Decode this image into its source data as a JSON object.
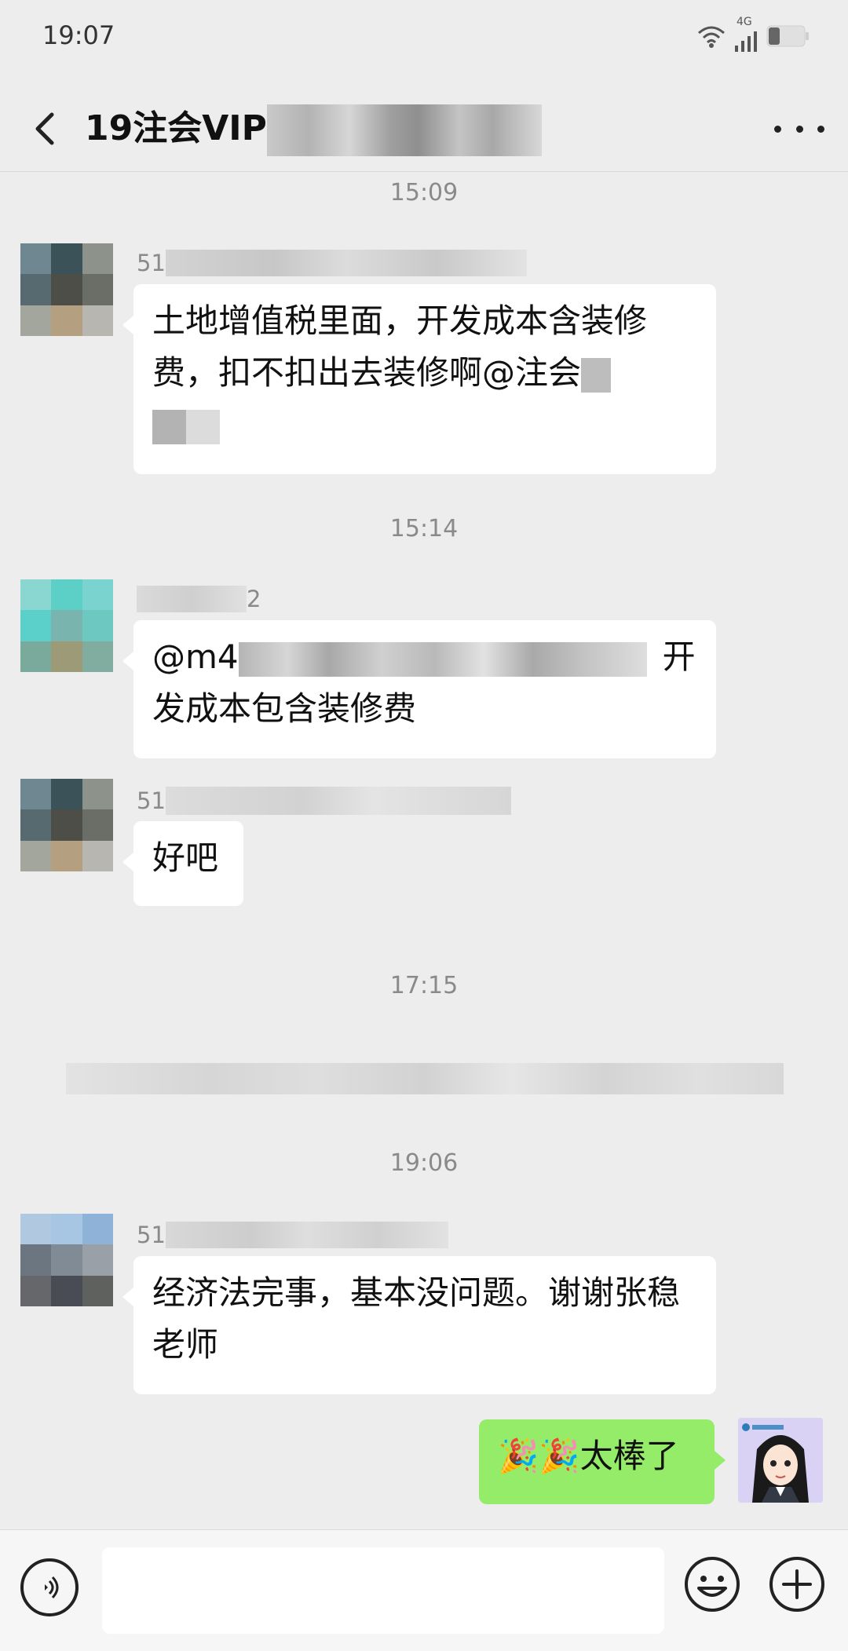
{
  "status_bar": {
    "time": "19:07",
    "network": "4G"
  },
  "nav": {
    "title_prefix": "19注会VIP"
  },
  "timestamps": [
    "15:09",
    "15:14",
    "17:15",
    "19:06"
  ],
  "messages": [
    {
      "sender_prefix": "51",
      "text_a": "土地增值税里面，开发成本含装修费，扣不扣出去装修啊@注会",
      "text_b": ""
    },
    {
      "sender_suffix": "2",
      "text_a": "@m4",
      "text_b": "开发成本包含装修费"
    },
    {
      "sender_prefix": "51",
      "text_a": "好吧"
    },
    {
      "sender_prefix": "51",
      "text_a": "经济法完事，基本没问题。谢谢张稳老师"
    },
    {
      "text_a": "🎉🎉太棒了"
    }
  ],
  "colors": {
    "background": "#ededed",
    "my_bubble": "#95ec69",
    "other_bubble": "#ffffff",
    "timestamp": "#8a8a8a"
  },
  "icons": [
    "back-icon",
    "more-icon",
    "wifi-icon",
    "signal-icon",
    "battery-icon",
    "voice-icon",
    "emoji-icon",
    "plus-icon"
  ]
}
